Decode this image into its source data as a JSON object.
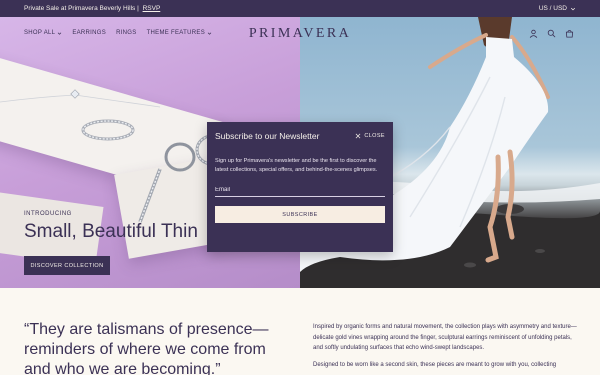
{
  "announcement": {
    "message": "Private Sale at Primavera Beverly Hills |",
    "link": "RSVP",
    "locale": "US / USD"
  },
  "nav": {
    "links": [
      {
        "label": "SHOP ALL",
        "has_dropdown": true
      },
      {
        "label": "EARRINGS",
        "has_dropdown": false
      },
      {
        "label": "RINGS",
        "has_dropdown": false
      },
      {
        "label": "THEME FEATURES",
        "has_dropdown": true
      }
    ],
    "logo": "PRIMAVERA",
    "icons": [
      "user-icon",
      "search-icon",
      "cart-icon"
    ]
  },
  "hero": {
    "kicker": "INTRODUCING",
    "title": "Small, Beautiful Thin",
    "button": "DISCOVER COLLECTION"
  },
  "popup": {
    "title": "Subscribe to our Newsletter",
    "close_label": "CLOSE",
    "description": "Sign up for Primavera's newsletter and be the first to discover the latest collections, special offers, and behind-the-scenes glimpses.",
    "email_placeholder": "Email",
    "submit_label": "SUBSCRIBE"
  },
  "lower": {
    "quote": "“They are talismans of presence—reminders of where we come from and who we are becoming.”",
    "paragraphs": [
      "Inspired by organic forms and natural movement, the collection plays with asymmetry and texture—delicate gold vines wrapping around the finger, sculptural earrings reminiscent of unfolding petals, and softly undulating surfaces that echo wind-swept landscapes.",
      "Designed to be worn like a second skin, these pieces are meant to grow with you, collecting"
    ]
  },
  "colors": {
    "brand": "#3b3155",
    "cream": "#f7ede2",
    "page_bg": "#fbf8f2"
  }
}
